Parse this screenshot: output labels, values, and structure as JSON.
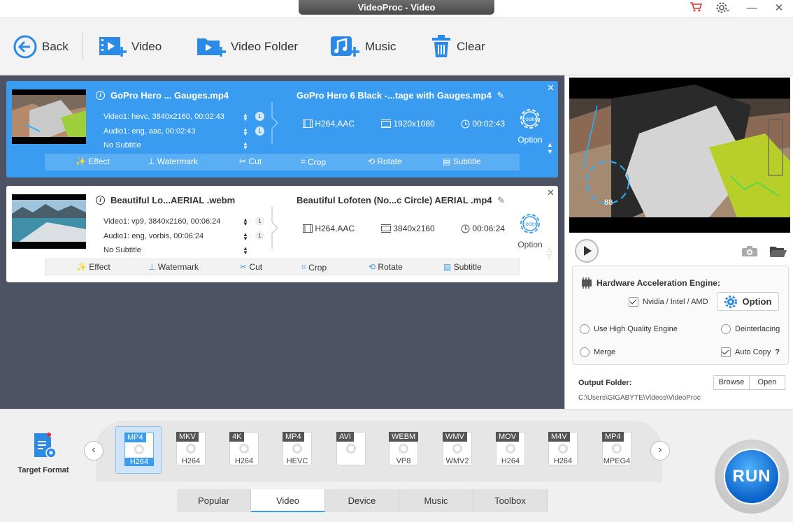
{
  "window": {
    "title": "VideoProc - Video"
  },
  "toolbar": {
    "back_label": "Back",
    "video_label": "Video",
    "folder_label": "Video Folder",
    "music_label": "Music",
    "clear_label": "Clear"
  },
  "files": [
    {
      "src_name": "GoPro Hero ... Gauges.mp4",
      "video_track": "Video1: hevc, 3840x2160, 00:02:43",
      "audio_track": "Audio1: eng, aac, 00:02:43",
      "subtitle": "No Subtitle",
      "video_num": "1",
      "audio_num": "1",
      "out_name": "GoPro Hero 6 Black -...tage with Gauges.mp4",
      "codec": "H264,AAC",
      "resolution": "1920x1080",
      "duration": "00:02:43",
      "codec_label": "codec",
      "option_label": "Option"
    },
    {
      "src_name": "Beautiful Lo...AERIAL .webm",
      "video_track": "Video1: vp9, 3840x2160, 00:06:24",
      "audio_track": "Audio1: eng, vorbis, 00:06:24",
      "subtitle": "No Subtitle",
      "video_num": "1",
      "audio_num": "1",
      "out_name": "Beautiful Lofoten (No...c Circle) AERIAL .mp4",
      "codec": "H264,AAC",
      "resolution": "3840x2160",
      "duration": "00:06:24",
      "codec_label": "codec",
      "option_label": "Option"
    }
  ],
  "edit_tools": {
    "effect": "Effect",
    "watermark": "Watermark",
    "cut": "Cut",
    "crop": "Crop",
    "rotate": "Rotate",
    "subtitle": "Subtitle"
  },
  "hardware": {
    "title": "Hardware Acceleration Engine:",
    "gpu_label": "Nvidia / Intel / AMD",
    "gpu_checked": true,
    "option_label": "Option",
    "high_quality_label": "Use High Quality Engine",
    "deinterlacing_label": "Deinterlacing",
    "merge_label": "Merge",
    "auto_copy_label": "Auto Copy",
    "help": "?"
  },
  "output": {
    "label": "Output Folder:",
    "browse_label": "Browse",
    "open_label": "Open",
    "path": "C:\\Users\\GIGABYTE\\Videos\\VideoProc"
  },
  "target_format": {
    "label": "Target Format"
  },
  "formats": [
    {
      "tag": "MP4",
      "codec": "H264",
      "active": true
    },
    {
      "tag": "MKV",
      "codec": "H264"
    },
    {
      "tag": "4K",
      "codec": "H264"
    },
    {
      "tag": "MP4",
      "codec": "HEVC"
    },
    {
      "tag": "AVI",
      "codec": ""
    },
    {
      "tag": "WEBM",
      "codec": "VP8"
    },
    {
      "tag": "WMV",
      "codec": "WMV2"
    },
    {
      "tag": "MOV",
      "codec": "H264"
    },
    {
      "tag": "M4V",
      "codec": "H264"
    },
    {
      "tag": "MP4",
      "codec": "MPEG4"
    }
  ],
  "tabs": [
    "Popular",
    "Video",
    "Device",
    "Music",
    "Toolbox"
  ],
  "active_tab": "Video",
  "run_label": "RUN",
  "colors": {
    "accent": "#3a9cf0",
    "run": "#0a63c9",
    "cart": "#e03030"
  }
}
